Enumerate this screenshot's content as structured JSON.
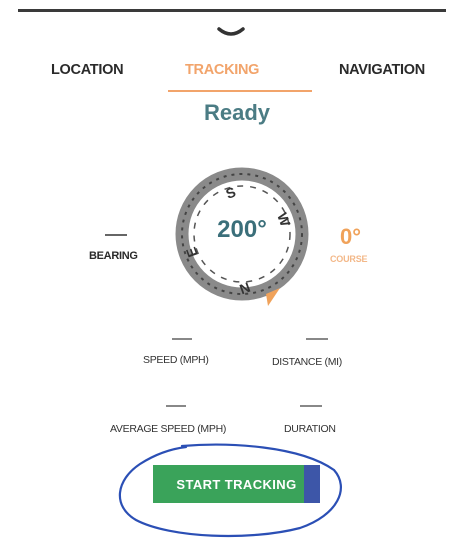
{
  "tabs": [
    {
      "label": "LOCATION"
    },
    {
      "label": "TRACKING",
      "active": true
    },
    {
      "label": "NAVIGATION"
    }
  ],
  "status": "Ready",
  "compass": {
    "heading": "200°",
    "directions": [
      "S",
      "W",
      "N",
      "E"
    ]
  },
  "bearing": {
    "value": "",
    "label": "BEARING"
  },
  "course": {
    "value": "0°",
    "label": "COURSE"
  },
  "stats": {
    "speed": {
      "value": "",
      "label": "SPEED (MPH)"
    },
    "distance": {
      "value": "",
      "label": "DISTANCE (MI)"
    },
    "average_speed": {
      "value": "",
      "label": "AVERAGE SPEED (MPH)"
    },
    "duration": {
      "value": "",
      "label": "DURATION"
    }
  },
  "start_button": {
    "label": "START TRACKING"
  },
  "colors": {
    "accent": "#f2a46b",
    "status": "#4b7c84",
    "button": "#3aa35a",
    "annotation": "#2b4fb5"
  },
  "icons": {
    "drag_handle": "chevron-down-icon",
    "compass": "compass-icon",
    "needle": "compass-needle-icon"
  }
}
